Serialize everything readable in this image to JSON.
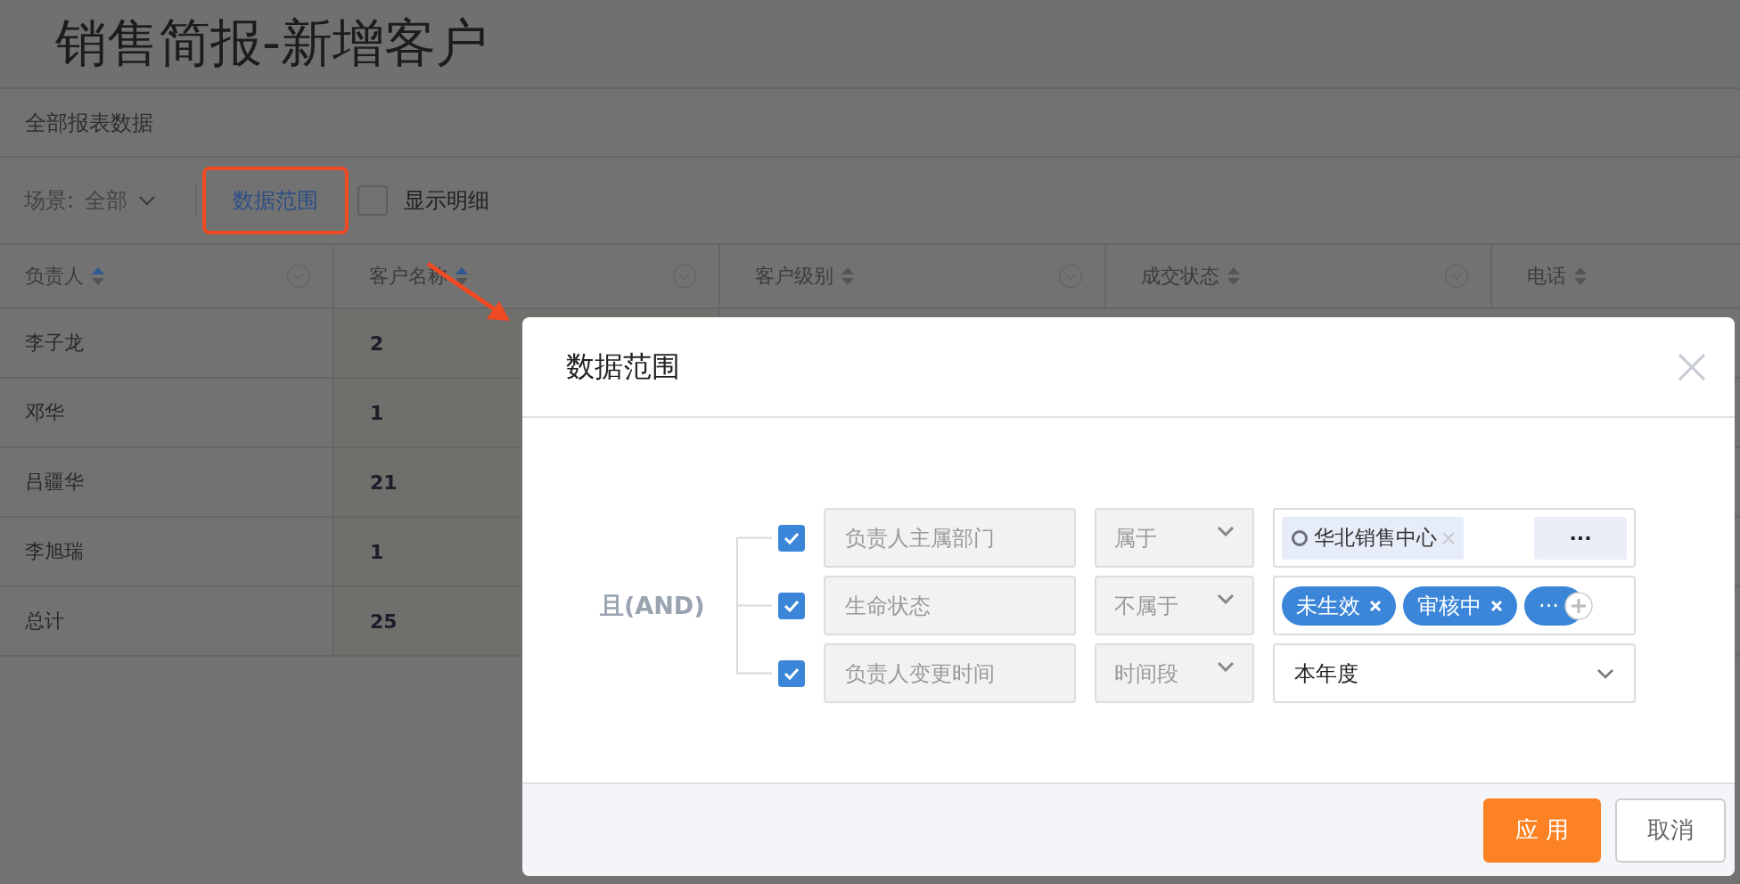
{
  "page_title": "销售简报-新增客户",
  "report_scope": "全部报表数据",
  "toolbar": {
    "scene_label": "场景:",
    "scene_value": "全部",
    "data_range_button": "数据范围",
    "show_detail": {
      "label": "显示明细",
      "checked": false
    }
  },
  "table": {
    "columns": [
      {
        "label": "负责人",
        "sort_active": true
      },
      {
        "label": "客户名称",
        "sort_active": true
      },
      {
        "label": "客户级别",
        "sort_active": false
      },
      {
        "label": "成交状态",
        "sort_active": false
      },
      {
        "label": "电话",
        "sort_active": false
      }
    ],
    "rows": [
      {
        "cells": [
          "李子龙",
          "2"
        ]
      },
      {
        "cells": [
          "邓华",
          "1"
        ]
      },
      {
        "cells": [
          "吕疆华",
          "21"
        ]
      },
      {
        "cells": [
          "李旭瑞",
          "1"
        ]
      },
      {
        "cells": [
          "总计",
          "25"
        ]
      }
    ]
  },
  "dialog": {
    "title": "数据范围",
    "logic": "且(AND)",
    "conditions": [
      {
        "checked": true,
        "field": "负责人主属部门",
        "operator": "属于",
        "value": {
          "kind": "org",
          "tags": [
            "华北销售中心"
          ],
          "more": "···"
        }
      },
      {
        "checked": true,
        "field": "生命状态",
        "operator": "不属于",
        "value": {
          "kind": "tags",
          "tags": [
            "未生效",
            "审核中"
          ],
          "more": "···"
        }
      },
      {
        "checked": true,
        "field": "负责人变更时间",
        "operator": "时间段",
        "value": {
          "kind": "select",
          "text": "本年度"
        }
      }
    ],
    "buttons": [
      {
        "label": "应 用",
        "kind": "primary"
      },
      {
        "label": "取消",
        "kind": "secondary"
      }
    ]
  }
}
